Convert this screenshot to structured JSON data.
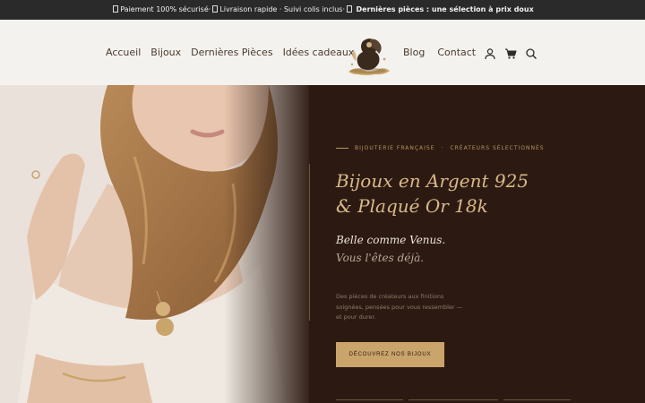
{
  "announcement": {
    "part1": "Paiement 100% sécurisé",
    "sep1": "·",
    "part2": "Livraison rapide · Suivi colis inclus",
    "sep2": "·",
    "highlight": "Dernières pièces : une sélection à prix doux"
  },
  "nav": {
    "left": [
      "Accueil",
      "Bijoux",
      "Dernières Pièces",
      "Idées cadeaux"
    ],
    "right": [
      "Blog",
      "Contact"
    ]
  },
  "icons": [
    "account-icon",
    "cart-icon",
    "search-icon"
  ],
  "hero": {
    "eyebrow_a": "BIJOUTERIE FRANÇAISE",
    "eyebrow_b": "CRÉATEURS SÉLECTIONNÉS",
    "headline_line1": "Bijoux en Argent 925",
    "headline_line2": "& Plaqué Or 18k",
    "tagline1": "Belle comme Venus.",
    "tagline2": "Vous l'êtes déjà.",
    "desc_line1": "Des pièces de créateurs aux finitions",
    "desc_line2": "soignées, pensées pour vous ressembler —",
    "desc_line3": "et pour durer.",
    "cta": "DÉCOUVREZ NOS BIJOUX"
  },
  "colors": {
    "topbar": "#2a2a2a",
    "header": "#f4f2ee",
    "hero_bg": "#2c1a12",
    "gold": "#c9a46b",
    "headline": "#d9b889"
  }
}
